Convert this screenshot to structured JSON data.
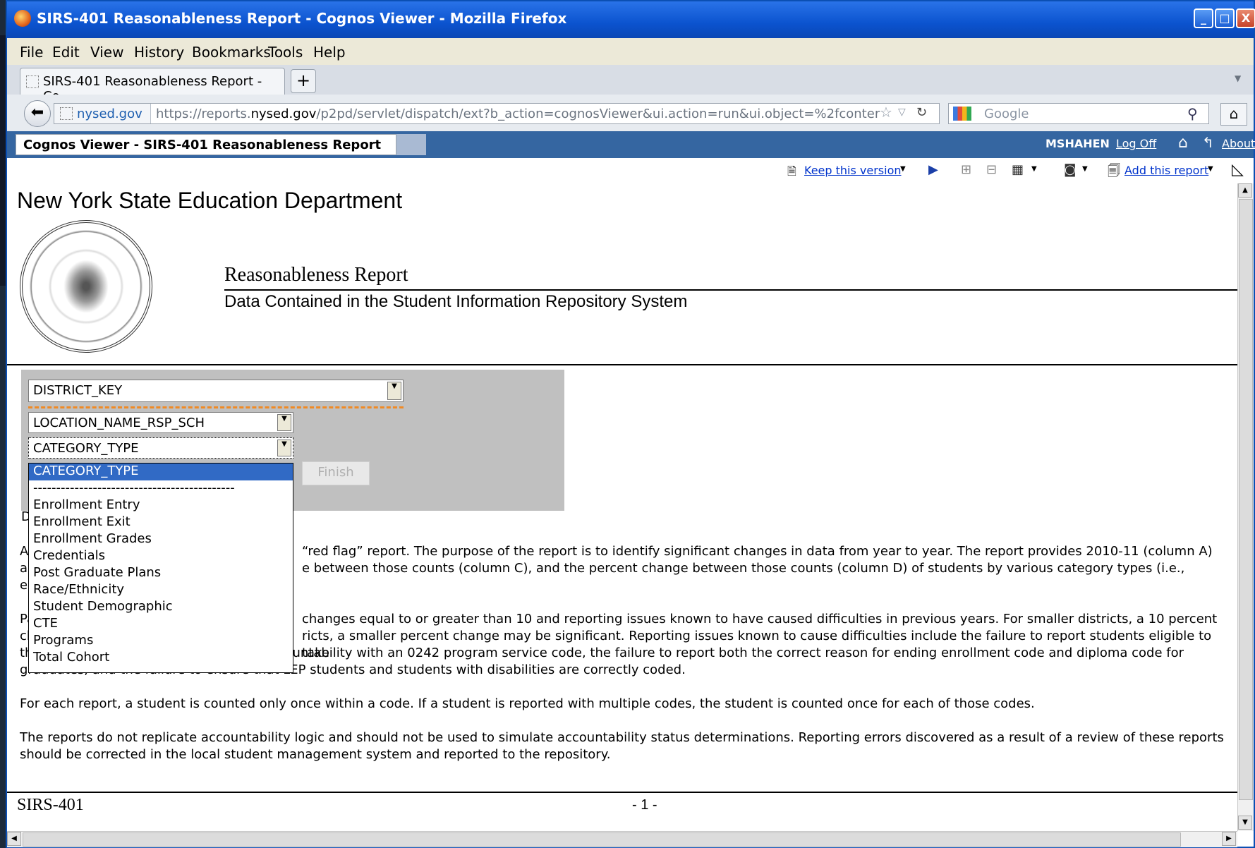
{
  "window": {
    "title": "SIRS-401 Reasonableness Report - Cognos Viewer - Mozilla Firefox",
    "controls": [
      "_",
      "□",
      "X"
    ]
  },
  "menubar": [
    "File",
    "Edit",
    "View",
    "History",
    "Bookmarks",
    "Tools",
    "Help"
  ],
  "tabs": [
    {
      "label": "SIRS-401 Reasonableness Report - Co..."
    }
  ],
  "newtab_label": "+",
  "navbar": {
    "identity": "nysed.gov",
    "url_prefix": "https://reports.",
    "url_domain": "nysed.gov",
    "url_rest": "/p2pd/servlet/dispatch/ext?b_action=cognosViewer&ui.action=run&ui.object=%2fconter",
    "search_placeholder": "Google"
  },
  "cognos": {
    "title": "Cognos Viewer - SIRS-401 Reasonableness Report",
    "user": "MSHAHEN",
    "logoff": "Log Off",
    "about": "About",
    "keep_version": "Keep this version",
    "add_report": "Add this report"
  },
  "report": {
    "department": "New York State Education Department",
    "title": "Reasonableness Report",
    "subtitle": "Data Contained in the Student Information Repository System",
    "prompts": {
      "district": "DISTRICT_KEY",
      "location": "LOCATION_NAME_RSP_SCH",
      "category": "CATEGORY_TYPE",
      "finish": "Finish"
    },
    "dropdown_options": [
      "CATEGORY_TYPE",
      "--------------------------------------------",
      "",
      "Enrollment Entry",
      "Enrollment Exit",
      "Enrollment Grades",
      "Credentials",
      "Post Graduate Plans",
      "Race/Ethnicity",
      "Student Demographic",
      "CTE",
      "Programs",
      "Total Cohort"
    ],
    "hidden_letter": "D",
    "para1_line1_left": "A",
    "para1_line1_right": "“red flag” report.  The purpose of the report is to identify significant changes in data from year to year.  The report provides 2010-11 (column A)",
    "para1_line2_left": "ar",
    "para1_line2_right": "e between those counts (column C), and the percent change between those counts (column D) of students by various category types (i.e.,",
    "para1_line3_left": "er",
    "para2_line1_left": "Pa",
    "para2_line1_right": "changes equal to or greater than 10 and reporting issues known to have caused difficulties in previous years. For smaller districts, a 10 percent",
    "para2_line2_left": "ch",
    "para2_line2_right": "ricts, a smaller percent change may be significant. Reporting issues known to cause difficulties include the failure to report students eligible to take",
    "para2_line3": "the NYSESLAT in lieu of the NYSTP for accountability with an 0242 program service code, the failure to report both the correct reason for ending enrollment code and diploma code for",
    "para2_line4": "graduates, and the failure to ensure that LEP students and students with disabilities are correctly coded.",
    "para3": "For each report, a student is counted only once within a code. If a student is reported with multiple codes, the student is counted once for each of those codes.",
    "para4_line1": "The reports do not replicate accountability logic and should not be used to simulate accountability status determinations. Reporting errors discovered as a result of a review of these reports",
    "para4_line2": "should be corrected in the local student management system and reported to the repository.",
    "footer_left": "SIRS-401",
    "footer_center": "- 1 -"
  }
}
